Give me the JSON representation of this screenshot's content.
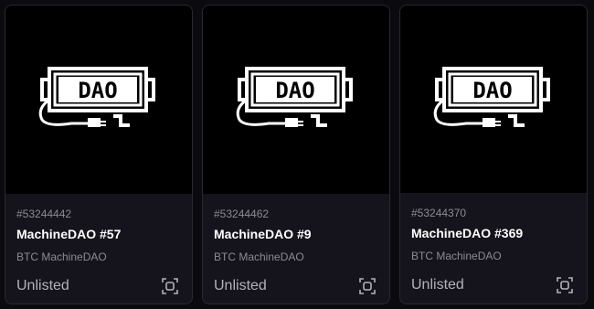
{
  "cards": [
    {
      "inscription": "#53244442",
      "name": "MachineDAO #57",
      "collection": "BTC MachineDAO",
      "status": "Unlisted",
      "image_text": "DAO"
    },
    {
      "inscription": "#53244462",
      "name": "MachineDAO #9",
      "collection": "BTC MachineDAO",
      "status": "Unlisted",
      "image_text": "DAO"
    },
    {
      "inscription": "#53244370",
      "name": "MachineDAO #369",
      "collection": "BTC MachineDAO",
      "status": "Unlisted",
      "image_text": "DAO"
    }
  ],
  "icons": {
    "action": "scan-icon"
  },
  "colors": {
    "page_background": "#0b0a0e",
    "card_background": "#15131b",
    "card_border": "#2a2832",
    "muted_text": "#8d8a97",
    "status_text": "#b4b1bd"
  }
}
